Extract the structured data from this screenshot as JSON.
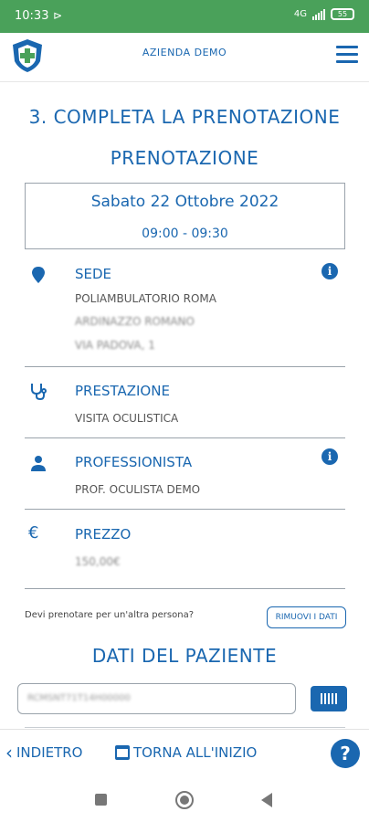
{
  "status_bar": {
    "time": "10:33",
    "battery": "55"
  },
  "header": {
    "company": "AZIENDA DEMO"
  },
  "page": {
    "step_title": "3. COMPLETA LA PRENOTAZIONE",
    "sub_title": "PRENOTAZIONE",
    "date": "Sabato 22 Ottobre 2022",
    "time_slot": "09:00 - 09:30"
  },
  "sede": {
    "label": "SEDE",
    "line1": "POLIAMBULATORIO ROMA",
    "line2": "ARDINAZZO ROMANO",
    "line3": "VIA PADOVA, 1"
  },
  "prestazione": {
    "label": "PRESTAZIONE",
    "value": "VISITA OCULISTICA"
  },
  "professionista": {
    "label": "PROFESSIONISTA",
    "value": "PROF. OCULISTA DEMO"
  },
  "prezzo": {
    "label": "PREZZO",
    "value": "150,00€",
    "currency_symbol": "€"
  },
  "other_person": {
    "question": "Devi prenotare per un'altra persona?",
    "remove_label": "RIMUOVI I DATI"
  },
  "patient": {
    "title": "DATI DEL PAZIENTE",
    "tax_code_value": "RCMSNT71T14H00000"
  },
  "footer": {
    "back_label": "INDIETRO",
    "home_label": "TORNA ALL'INIZIO",
    "help_label": "?"
  },
  "colors": {
    "accent": "#1a67b0",
    "status_bar": "#4aa15a",
    "divider": "#9aa3ab"
  }
}
